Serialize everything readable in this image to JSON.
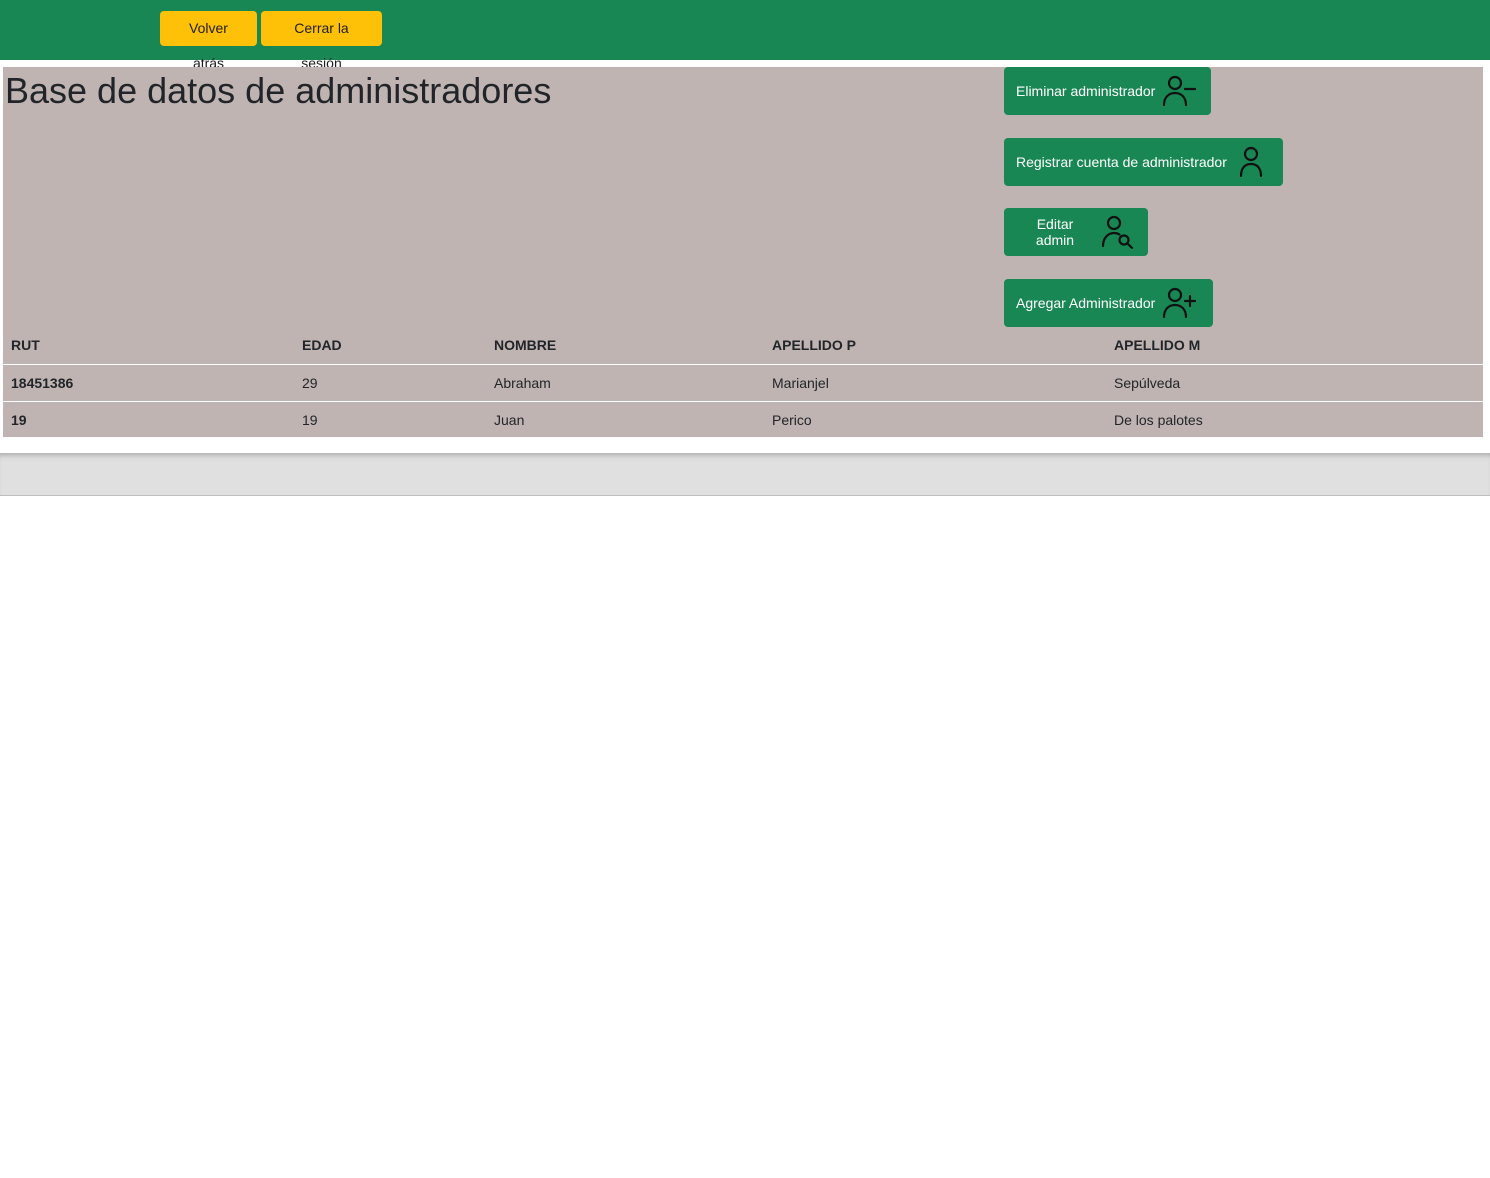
{
  "nav": {
    "back_label": "Volver atrás",
    "logout_label": "Cerrar la sesión"
  },
  "main": {
    "title": "Base de datos de administradores",
    "actions": [
      {
        "label": "Eliminar administrador",
        "icon": "person-minus-icon"
      },
      {
        "label": "Registrar cuenta de administrador",
        "icon": "person-icon"
      },
      {
        "label": "Editar admin",
        "icon": "person-search-icon"
      },
      {
        "label": "Agregar Administrador",
        "icon": "person-plus-icon"
      }
    ]
  },
  "table": {
    "headers": [
      "RUT",
      "EDAD",
      "NOMBRE",
      "APELLIDO P",
      "APELLIDO M"
    ],
    "rows": [
      [
        "18451386",
        "29",
        "Abraham",
        "Marianjel",
        "Sepúlveda"
      ],
      [
        "19",
        "19",
        "Juan",
        "Perico",
        "De los palotes"
      ]
    ]
  },
  "colors": {
    "topbar": "#198754",
    "nav_button": "#ffc107",
    "action_button": "#198754",
    "panel": "#c0b4b3",
    "footer": "#e0e0e0"
  }
}
